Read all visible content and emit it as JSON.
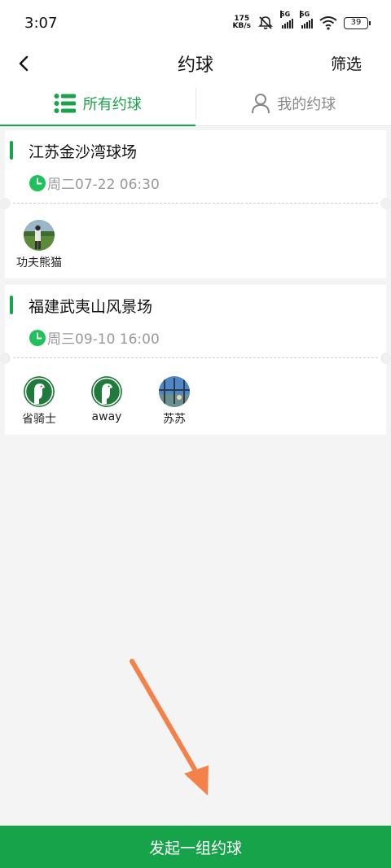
{
  "status_bar": {
    "time": "3:07",
    "net_speed_value": "175",
    "net_speed_unit": "KB/s",
    "sim1_tag": "5G",
    "sim2_tag": "5G",
    "battery": "39",
    "icons": [
      "mute-icon",
      "signal-icon",
      "signal-icon",
      "wifi-icon",
      "battery-icon"
    ]
  },
  "nav": {
    "title": "约球",
    "filter_label": "筛选",
    "back_icon": "back-arrow-icon"
  },
  "tabs": [
    {
      "label": "所有约球",
      "active": true,
      "icon": "list-icon"
    },
    {
      "label": "我的约球",
      "active": false,
      "icon": "person-icon"
    }
  ],
  "colors": {
    "accent": "#1aa34a",
    "button": "#16a34a",
    "annotation_arrow": "#f5814a"
  },
  "games": [
    {
      "course": "江苏金沙湾球场",
      "time": "周二07-22 06:30",
      "players": [
        {
          "name": "功夫熊猫",
          "avatar": "photo-avatar"
        }
      ]
    },
    {
      "course": "福建武夷山风景场",
      "time": "周三09-10 16:00",
      "players": [
        {
          "name": "省骑士",
          "avatar": "golfer-logo-avatar"
        },
        {
          "name": "away",
          "avatar": "golfer-logo-avatar"
        },
        {
          "name": "苏苏",
          "avatar": "photo-avatar"
        }
      ]
    }
  ],
  "bottom_button": {
    "label": "发起一组约球"
  }
}
